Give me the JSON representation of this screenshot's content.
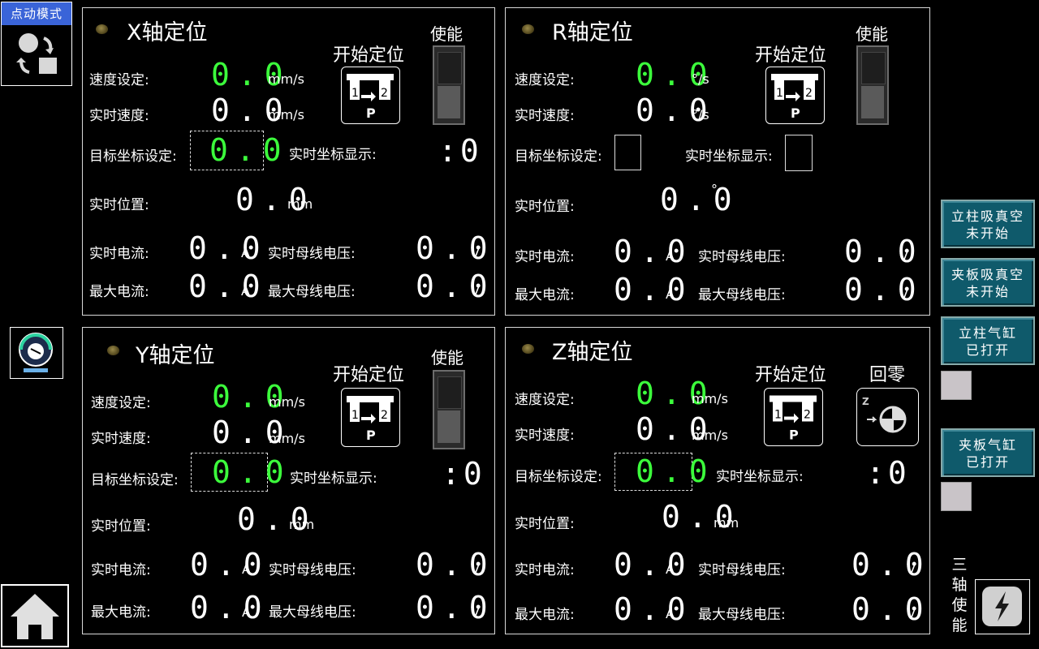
{
  "mode_label": "点动模式",
  "labels": {
    "speed_set": "速度设定:",
    "real_speed": "实时速度:",
    "target_set": "目标坐标设定:",
    "coord_display": "实时坐标显示:",
    "real_pos": "实时位置:",
    "real_current": "实时电流:",
    "max_current": "最大电流:",
    "real_bus_v": "实时母线电压:",
    "max_bus_v": "最大母线电压:",
    "start_pos": "开始定位",
    "enable": "使能",
    "home": "回零"
  },
  "axes": {
    "x": {
      "title": "X轴定位",
      "speed_set": "0.0",
      "speed_unit": "mm/s",
      "real_speed": "0.0",
      "target": "0.0",
      "coord": ":0",
      "pos": "0.0",
      "pos_unit": "mm",
      "cur": "0.0",
      "max_cur": "0.0",
      "bus_v": "0.0",
      "max_bus_v": "0.0",
      "a": "A",
      "v": "V"
    },
    "r": {
      "title": "R轴定位",
      "speed_set": "0.0",
      "speed_unit": "°/s",
      "real_speed": "0.0",
      "pos": "0.0",
      "pos_unit": "°",
      "cur": "0.0",
      "max_cur": "0.0",
      "bus_v": "0.0",
      "max_bus_v": "0.0",
      "a": "A",
      "v": "V"
    },
    "y": {
      "title": "Y轴定位",
      "speed_set": "0.0",
      "speed_unit": "mm/s",
      "real_speed": "0.0",
      "target": "0.0",
      "coord": ":0",
      "pos": "0.0",
      "pos_unit": "mm",
      "cur": "0.0",
      "max_cur": "0.0",
      "bus_v": "0.0",
      "max_bus_v": "0.0",
      "a": "A",
      "v": "V"
    },
    "z": {
      "title": "Z轴定位",
      "speed_set": "0.0",
      "speed_unit": "mm/s",
      "real_speed": "0.0",
      "target": "0.0",
      "coord": ":0",
      "pos": "0.0",
      "pos_unit": "mm",
      "cur": "0.0",
      "max_cur": "0.0",
      "bus_v": "0.0",
      "max_bus_v": "0.0",
      "a": "A",
      "v": "V"
    }
  },
  "side": {
    "btn1_l1": "立柱吸真空",
    "btn1_l2": "未开始",
    "btn2_l1": "夹板吸真空",
    "btn2_l2": "未开始",
    "btn3_l1": "立柱气缸",
    "btn3_l2": "已打开",
    "btn4_l1": "夹板气缸",
    "btn4_l2": "已打开",
    "three_axis_1": "三",
    "three_axis_2": "轴",
    "three_axis_3": "使",
    "three_axis_4": "能"
  },
  "colors": {
    "digit_green": "#3cff3c",
    "button_teal": "#0f5a6b",
    "panel_border": "#d8d8d8"
  }
}
